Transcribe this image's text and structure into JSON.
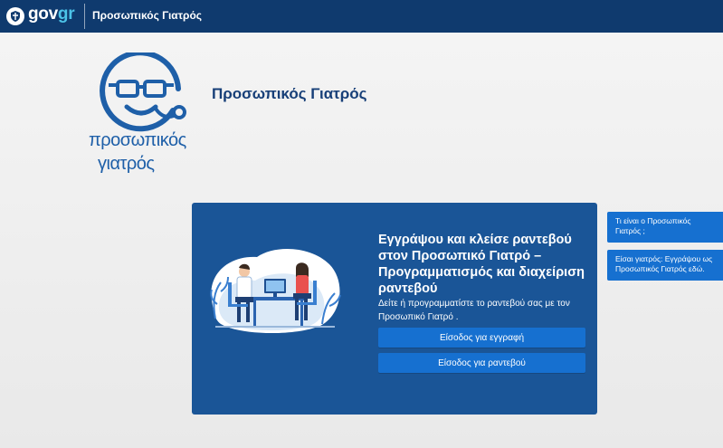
{
  "header": {
    "brand_gov": "gov",
    "brand_gr": "gr",
    "service_title": "Προσωπικός Γιατρός"
  },
  "logo": {
    "line1": "προσωπικός",
    "line2": "γιατρός"
  },
  "page": {
    "heading": "Προσωπικός Γιατρός"
  },
  "panel": {
    "title": "Εγγράψου και κλείσε ραντεβού στον Προσωπικό Γιατρό – Προγραμματισμός και διαχείριση ραντεβού",
    "description": "Δείτε ή προγραμματίστε το ραντεβού σας με τον Προσωπικό Γιατρό .",
    "register_button": "Είσοδος για εγγραφή",
    "appointment_button": "Είσοδος για ραντεβού"
  },
  "side_links": [
    {
      "label": "Τι είναι ο Προσωπικός Γιατρός ;"
    },
    {
      "label": "Είσαι γιατρός: Εγγράψου ως Προσωπικός Γιατρός εδώ."
    }
  ],
  "colors": {
    "topbar": "#0f3a6e",
    "accent": "#1670d0",
    "panel": "#1a5597",
    "logo_blue": "#1e5fa8"
  },
  "icons": {
    "emblem": "greek-emblem-icon",
    "logo": "doctor-face-logo-icon",
    "illustration": "doctor-patient-illustration"
  }
}
